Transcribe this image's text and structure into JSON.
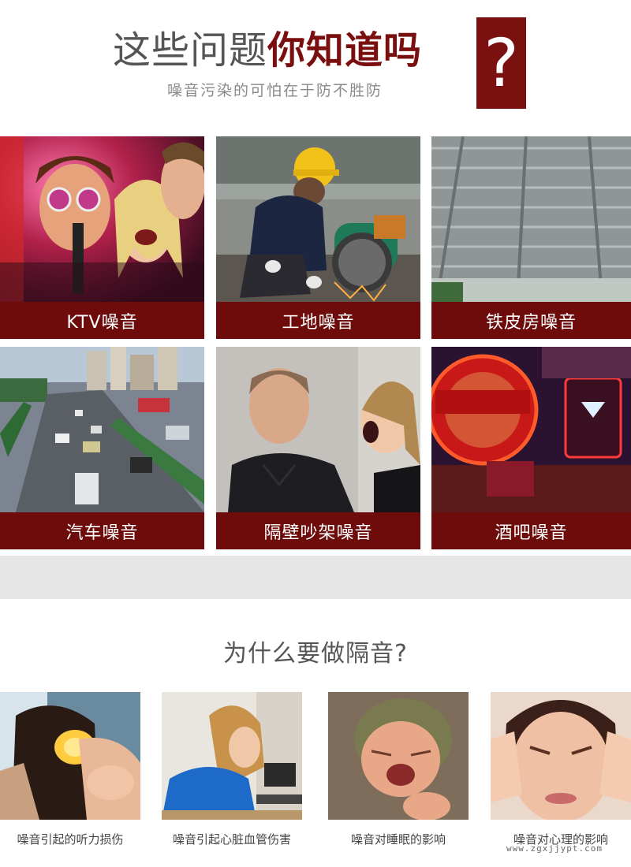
{
  "header": {
    "title_grey": "这些问题",
    "title_red": "你知道吗",
    "question_mark": "?",
    "subtitle": "噪音污染的可怕在于防不胜防",
    "accent_color": "#7a1010"
  },
  "noise_sources": [
    {
      "label": "KTV噪音",
      "icon": "karaoke-photo"
    },
    {
      "label": "工地噪音",
      "icon": "construction-photo"
    },
    {
      "label": "铁皮房噪音",
      "icon": "tin-roof-photo"
    },
    {
      "label": "汽车噪音",
      "icon": "traffic-photo"
    },
    {
      "label": "隔壁吵架噪音",
      "icon": "argument-photo"
    },
    {
      "label": "酒吧噪音",
      "icon": "bar-photo"
    }
  ],
  "section2": {
    "title": "为什么要做隔音?",
    "effects": [
      {
        "caption": "噪音引起的听力损伤",
        "icon": "ear-pain-photo"
      },
      {
        "caption": "噪音引起心脏血管伤害",
        "icon": "fatigue-photo"
      },
      {
        "caption": "噪音对睡眠的影响",
        "icon": "crying-baby-photo"
      },
      {
        "caption": "噪音对心理的影响",
        "icon": "headache-photo"
      }
    ]
  },
  "watermark": "www.zgxjjypt.com"
}
